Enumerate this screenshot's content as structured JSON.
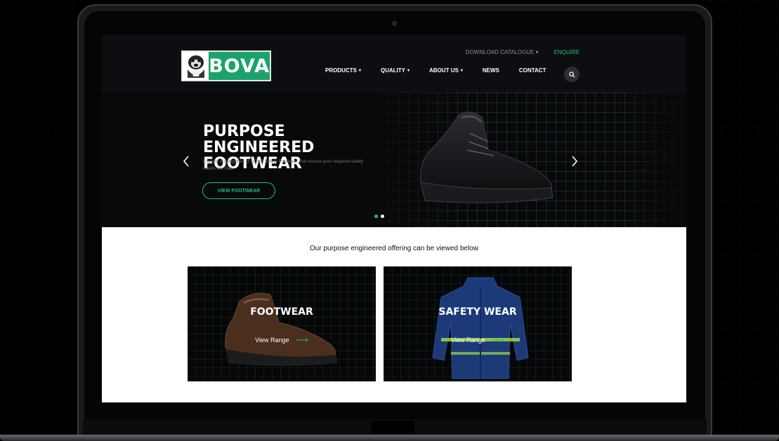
{
  "brand": {
    "name": "BOVA",
    "accent": "#1aa36a"
  },
  "top_links": [
    {
      "label": "DOWNLOAD CATALOGUE ▾",
      "green": false
    },
    {
      "label": "ENQUIRE",
      "green": true
    }
  ],
  "nav": [
    {
      "label": "PRODUCTS",
      "caret": "▾"
    },
    {
      "label": "QUALITY",
      "caret": "▾"
    },
    {
      "label": "ABOUT US",
      "caret": "▾"
    },
    {
      "label": "NEWS",
      "caret": ""
    },
    {
      "label": "CONTACT",
      "caret": ""
    }
  ],
  "hero": {
    "title": "PURPOSE ENGINEERED FOOTWEAR",
    "description": "Explore 4 categories of BOVA Safety Footwear that ensure your required safety needs are met.",
    "cta": "VIEW FOOTWEAR",
    "active_slide": 1,
    "slide_count": 2
  },
  "content": {
    "heading": "Our purpose engineered offering can be viewed below",
    "cards": [
      {
        "title": "FOOTWEAR",
        "link": "View Range"
      },
      {
        "title": "SAFETY WEAR",
        "link": "View Range"
      }
    ]
  },
  "icons": {
    "search": "search-icon",
    "prev": "chevron-left-icon",
    "next": "chevron-right-icon",
    "arrow": "arrow-right-icon"
  }
}
